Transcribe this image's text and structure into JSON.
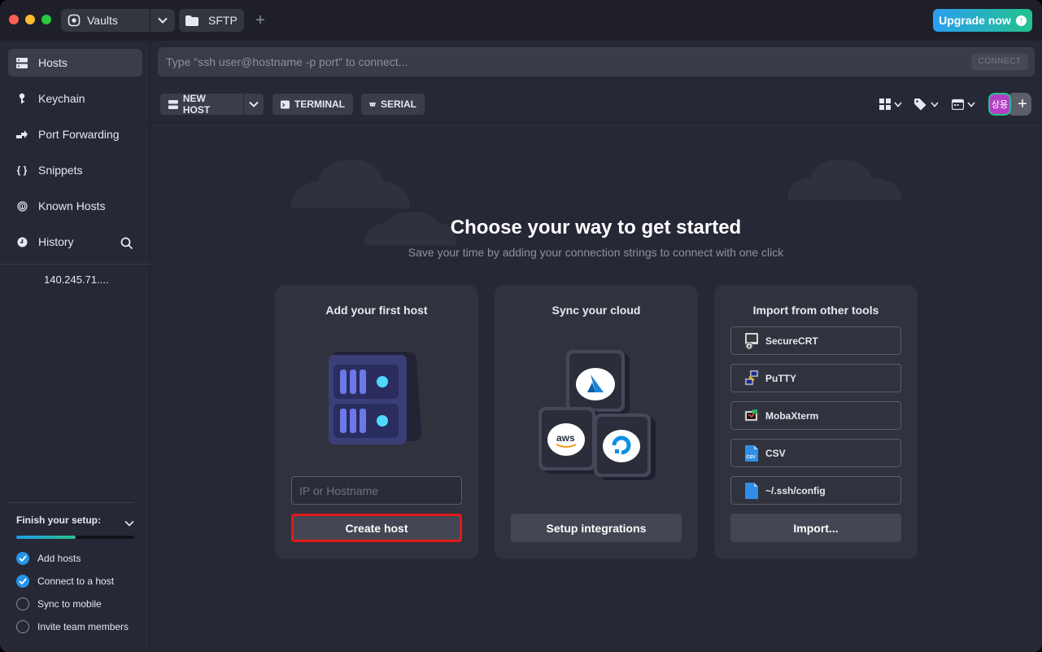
{
  "titlebar": {
    "tabs": [
      {
        "label": "Vaults",
        "icon": "vault-icon"
      },
      {
        "label": "SFTP",
        "icon": "folder-icon"
      }
    ],
    "add_tab_icon": "plus-icon",
    "upgrade_label": "Upgrade now"
  },
  "sidebar": {
    "items": [
      {
        "label": "Hosts",
        "icon": "hosts-grid-icon",
        "active": true
      },
      {
        "label": "Keychain",
        "icon": "key-icon"
      },
      {
        "label": "Port Forwarding",
        "icon": "port-forward-icon"
      },
      {
        "label": "Snippets",
        "icon": "braces-icon"
      },
      {
        "label": "Known Hosts",
        "icon": "fingerprint-icon"
      },
      {
        "label": "History",
        "icon": "clock-icon"
      }
    ],
    "recent_host": "140.245.71....",
    "setup": {
      "title": "Finish your setup:",
      "progress": 0.5,
      "steps": [
        {
          "label": "Add hosts",
          "done": true
        },
        {
          "label": "Connect to a host",
          "done": true
        },
        {
          "label": "Sync to mobile",
          "done": false
        },
        {
          "label": "Invite team members",
          "done": false
        }
      ]
    }
  },
  "connect": {
    "placeholder": "Type \"ssh user@hostname -p port\" to connect...",
    "button_label": "CONNECT"
  },
  "toolbar": {
    "new_host": "NEW HOST",
    "terminal": "TERMINAL",
    "serial": "SERIAL",
    "avatar_text": "상용"
  },
  "hero": {
    "title": "Choose your way to get started",
    "subtitle": "Save your time by adding your connection strings to connect with one click"
  },
  "cards": {
    "add_host": {
      "title": "Add your first host",
      "input_placeholder": "IP or Hostname",
      "button": "Create host"
    },
    "sync_cloud": {
      "title": "Sync your cloud",
      "button": "Setup integrations",
      "providers": [
        "Azure",
        "aws",
        "DigitalOcean"
      ]
    },
    "import": {
      "title": "Import from other tools",
      "items": [
        "SecureCRT",
        "PuTTY",
        "MobaXterm",
        "CSV",
        "~/.ssh/config"
      ],
      "button": "Import..."
    }
  },
  "colors": {
    "accent": "#2595e8",
    "highlight": "#e01a1a",
    "upgrade_start": "#2b9ef0",
    "upgrade_end": "#22c38e"
  }
}
